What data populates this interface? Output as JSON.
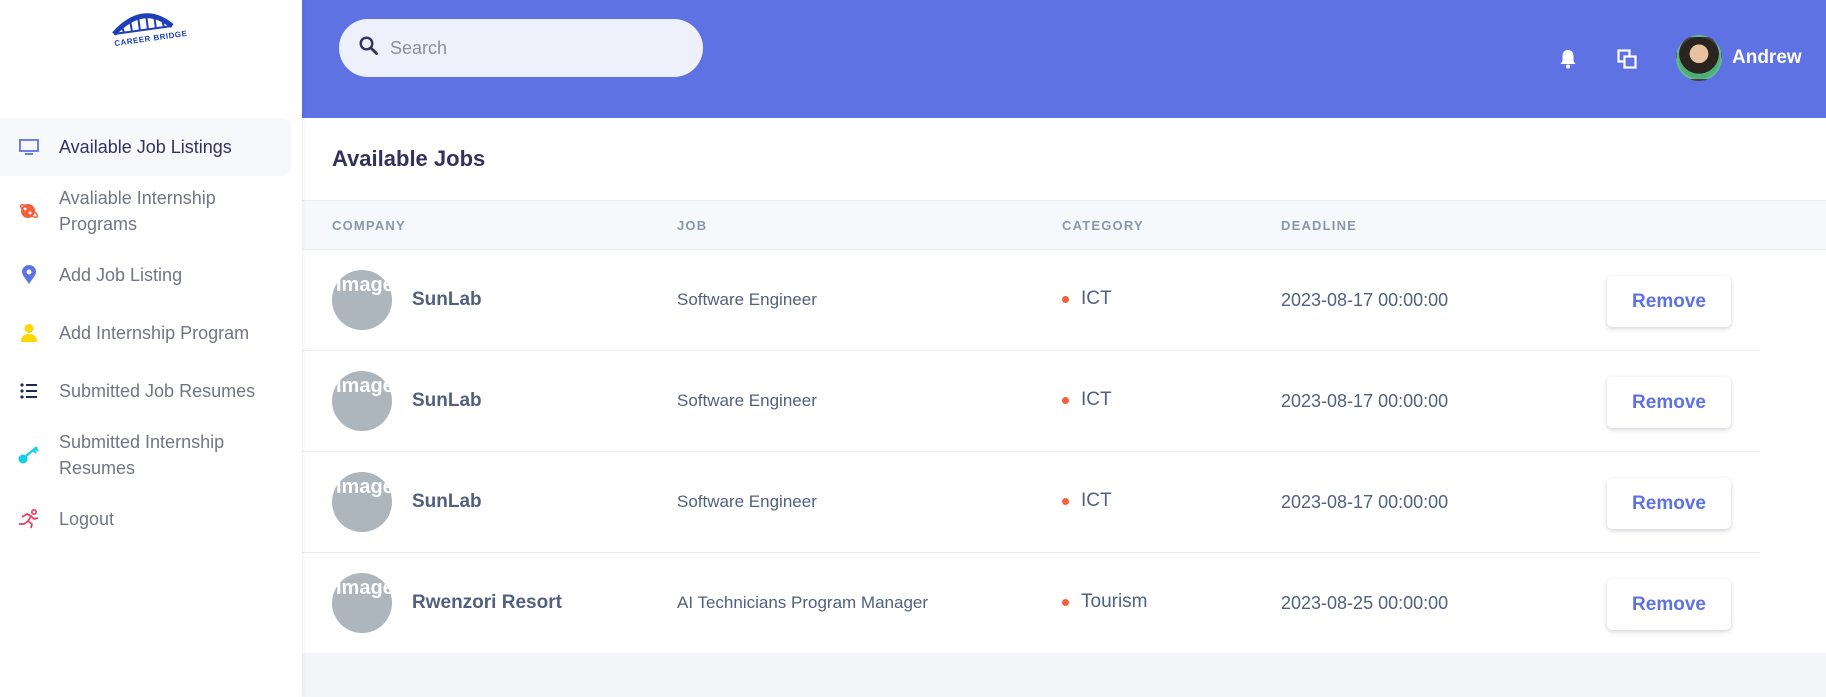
{
  "brand": {
    "logo_text": "CAREER BRIDGE",
    "accent": "#5e72e4"
  },
  "sidebar": {
    "items": [
      {
        "label": "Available Job Listings",
        "icon": "monitor-icon",
        "color": "#5e72e4",
        "active": true
      },
      {
        "label": "Avaliable Internship Programs",
        "icon": "planet-icon",
        "color": "#f5603a"
      },
      {
        "label": "Add Job Listing",
        "icon": "pin-icon",
        "color": "#5e72e4"
      },
      {
        "label": "Add Internship Program",
        "icon": "user-icon",
        "color": "#ffd600"
      },
      {
        "label": "Submitted Job Resumes",
        "icon": "list-icon",
        "color": "#172b4d"
      },
      {
        "label": "Submitted Internship Resumes",
        "icon": "key-icon",
        "color": "#11cdef"
      },
      {
        "label": "Logout",
        "icon": "running-icon",
        "color": "#f5365c"
      }
    ]
  },
  "header": {
    "search_placeholder": "Search",
    "user_name": "Andrew"
  },
  "jobs": {
    "title": "Available Jobs",
    "columns": [
      "COMPANY",
      "JOB",
      "CATEGORY",
      "DEADLINE"
    ],
    "image_alt": "Image",
    "remove_label": "Remove",
    "rows": [
      {
        "company": "SunLab",
        "job": "Software Engineer",
        "category": "ICT",
        "deadline": "2023-08-17 00:00:00"
      },
      {
        "company": "SunLab",
        "job": "Software Engineer",
        "category": "ICT",
        "deadline": "2023-08-17 00:00:00"
      },
      {
        "company": "SunLab",
        "job": "Software Engineer",
        "category": "ICT",
        "deadline": "2023-08-17 00:00:00"
      },
      {
        "company": "Rwenzori Resort",
        "job": "AI Technicians Program Manager",
        "category": "Tourism",
        "deadline": "2023-08-25 00:00:00"
      }
    ]
  }
}
